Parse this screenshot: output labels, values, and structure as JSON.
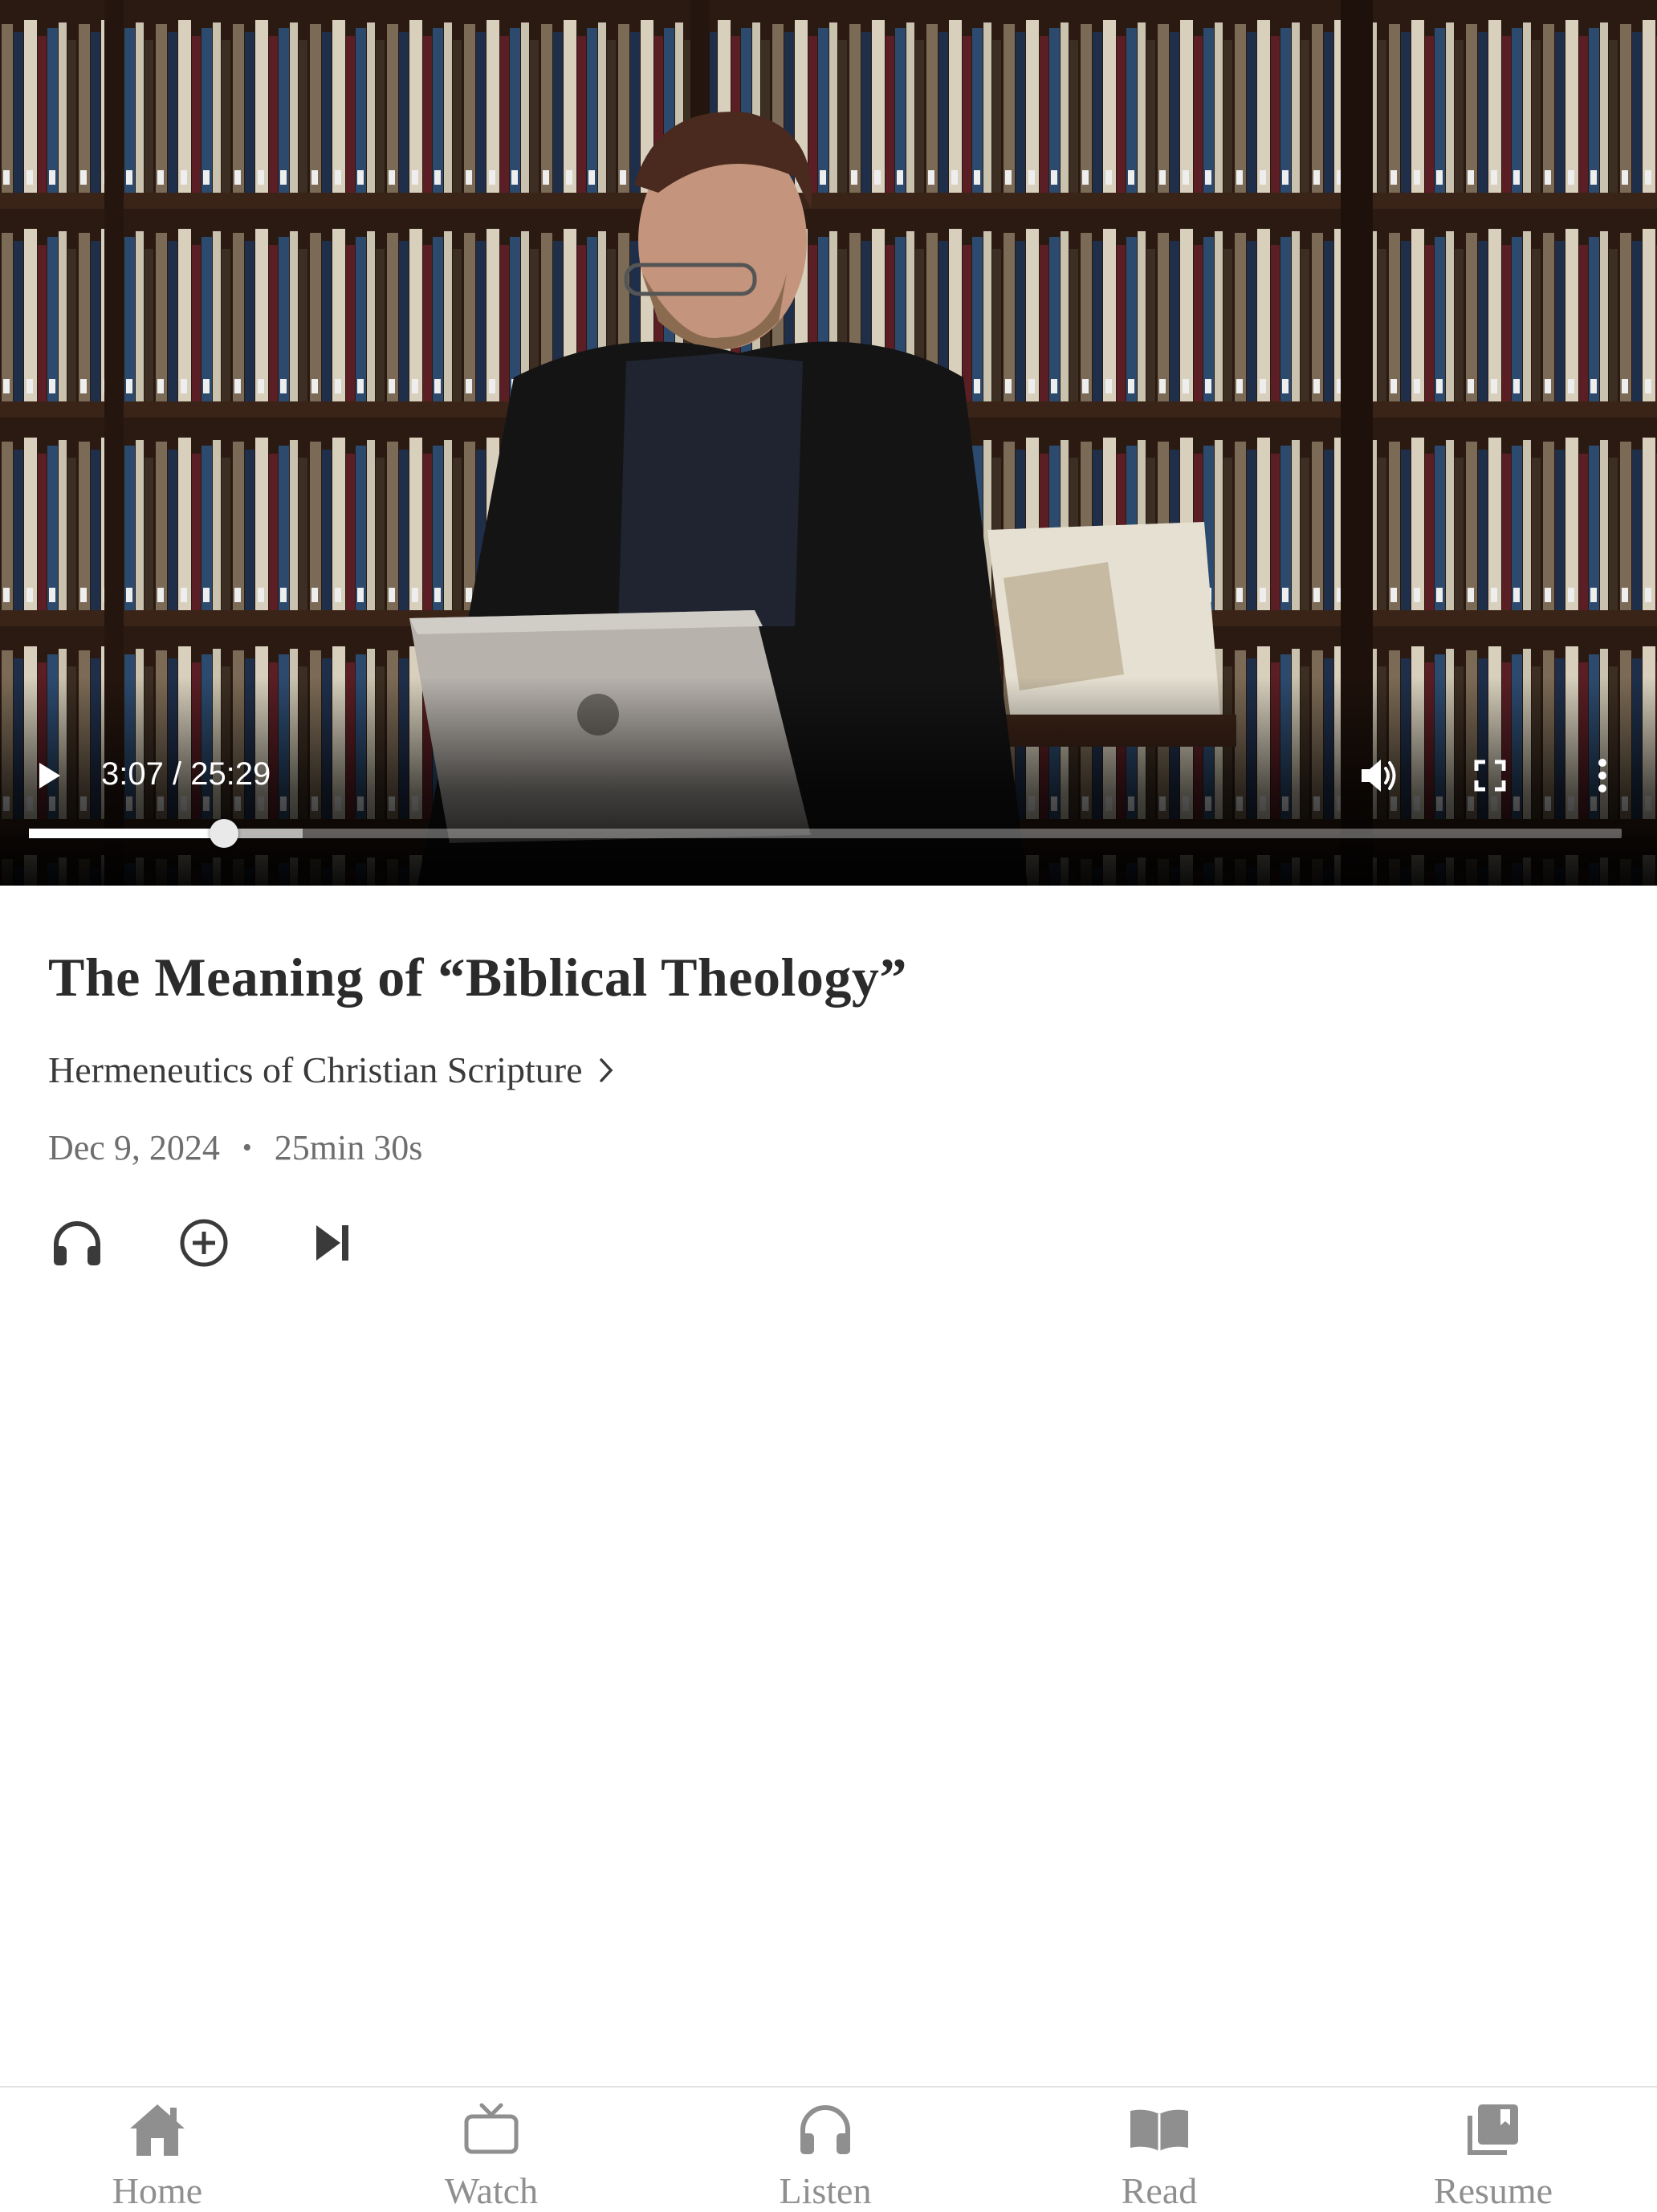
{
  "player": {
    "time_display": "3:07 / 25:29",
    "progress_fraction": 0.1224,
    "buffered_fraction": 0.172
  },
  "episode": {
    "title": "The Meaning of “Biblical Theology”",
    "series": "Hermeneutics of Christian Scripture",
    "date": "Dec 9, 2024",
    "duration": "25min 30s"
  },
  "actions": {
    "icons": [
      "headphones-icon",
      "add-circle-icon",
      "skip-next-icon"
    ]
  },
  "nav": {
    "items": [
      {
        "label": "Home",
        "icon": "home-icon"
      },
      {
        "label": "Watch",
        "icon": "tv-icon"
      },
      {
        "label": "Listen",
        "icon": "headphones-icon"
      },
      {
        "label": "Read",
        "icon": "book-icon"
      },
      {
        "label": "Resume",
        "icon": "library-icon"
      }
    ]
  },
  "colors": {
    "nav_inactive": "#8f8f8f",
    "title_text": "#2b2b2b",
    "meta_text": "#6e6e6e"
  }
}
